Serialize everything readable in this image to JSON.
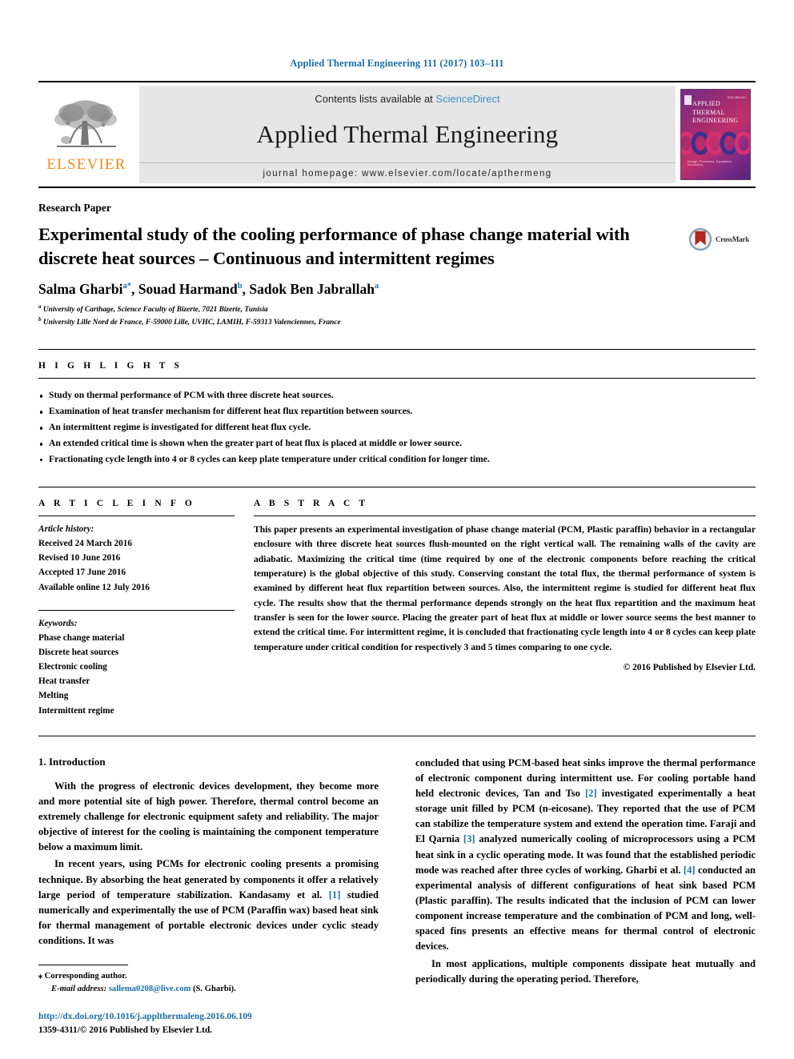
{
  "running_head": "Applied Thermal Engineering 111 (2017) 103–111",
  "masthead": {
    "publisher": "ELSEVIER",
    "contents_prefix": "Contents lists available at ",
    "sciencedirect": "ScienceDirect",
    "journal_name": "Applied Thermal Engineering",
    "homepage": "journal homepage: www.elsevier.com/locate/apthermeng",
    "cover": {
      "title_lines": [
        "APPLIED",
        "THERMAL",
        "ENGINEERING"
      ],
      "footer": "Design, Processes, Equipment, Economics",
      "issn": "ISSN 1359-4311"
    }
  },
  "article": {
    "type": "Research Paper",
    "title": "Experimental study of the cooling performance of phase change material with discrete heat sources – Continuous and intermittent regimes",
    "crossmark_label": "CrossMark",
    "authors": [
      {
        "name": "Salma Gharbi",
        "sup": "a",
        "star": "*"
      },
      {
        "name": "Souad Harmand",
        "sup": "b",
        "star": ""
      },
      {
        "name": "Sadok Ben Jabrallah",
        "sup": "a",
        "star": ""
      }
    ],
    "affiliations": [
      {
        "mark": "a",
        "text": "University of Carthage, Science Faculty of Bizerte, 7021 Bizerte, Tunisia"
      },
      {
        "mark": "b",
        "text": "University Lille Nord de France, F-59000 Lille, UVHC, LAMIH, F-59313 Valenciennes, France"
      }
    ]
  },
  "highlights": {
    "label": "H I G H L I G H T S",
    "items": [
      "Study on thermal performance of PCM with three discrete heat sources.",
      "Examination of heat transfer mechanism for different heat flux repartition between sources.",
      "An intermittent regime is investigated for different heat flux cycle.",
      "An extended critical time is shown when the greater part of heat flux is placed at middle or lower source.",
      "Fractionating cycle length into 4 or 8 cycles can keep plate temperature under critical condition for longer time."
    ]
  },
  "article_info": {
    "label": "A R T I C L E   I N F O",
    "history_label": "Article history:",
    "history": [
      "Received 24 March 2016",
      "Revised 10 June 2016",
      "Accepted 17 June 2016",
      "Available online 12 July 2016"
    ],
    "keywords_label": "Keywords:",
    "keywords": [
      "Phase change material",
      "Discrete heat sources",
      "Electronic cooling",
      "Heat transfer",
      "Melting",
      "Intermittent regime"
    ]
  },
  "abstract": {
    "label": "A B S T R A C T",
    "text": "This paper presents an experimental investigation of phase change material (PCM, Plastic paraffin) behavior in a rectangular enclosure with three discrete heat sources flush-mounted on the right vertical wall. The remaining walls of the cavity are adiabatic. Maximizing the critical time (time required by one of the electronic components before reaching the critical temperature) is the global objective of this study. Conserving constant the total flux, the thermal performance of system is examined by different heat flux repartition between sources. Also, the intermittent regime is studied for different heat flux cycle. The results show that the thermal performance depends strongly on the heat flux repartition and the maximum heat transfer is seen for the lower source. Placing the greater part of heat flux at middle or lower source seems the best manner to extend the critical time. For intermittent regime, it is concluded that fractionating cycle length into 4 or 8 cycles can keep plate temperature under critical condition for respectively 3 and 5 times comparing to one cycle.",
    "copyright": "© 2016 Published by Elsevier Ltd."
  },
  "body": {
    "section_title": "1. Introduction",
    "left_paragraphs": [
      "With the progress of electronic devices development, they become more and more potential site of high power. Therefore, thermal control become an extremely challenge for electronic equipment safety and reliability. The major objective of interest for the cooling is maintaining the component temperature below a maximum limit.",
      "In recent years, using PCMs for electronic cooling presents a promising technique. By absorbing the heat generated by components it offer a relatively large period of temperature stabilization. Kandasamy et al. [1] studied numerically and experimentally the use of PCM (Paraffin wax) based heat sink for thermal management of portable electronic devices under cyclic steady conditions. It was"
    ],
    "right_paragraphs": [
      "concluded that using PCM-based heat sinks improve the thermal performance of electronic component during intermittent use. For cooling portable hand held electronic devices, Tan and Tso [2] investigated experimentally a heat storage unit filled by PCM (n-eicosane). They reported that the use of PCM can stabilize the temperature system and extend the operation time. Faraji and El Qarnia [3] analyzed numerically cooling of microprocessors using a PCM heat sink in a cyclic operating mode. It was found that the established periodic mode was reached after three cycles of working. Gharbi et al. [4] conducted an experimental analysis of different configurations of heat sink based PCM (Plastic paraffin). The results indicated that the inclusion of PCM can lower component increase temperature and the combination of PCM and long, well-spaced fins presents an effective means for thermal control of electronic devices.",
      "In most applications, multiple components dissipate heat mutually and periodically during the operating period. Therefore,"
    ]
  },
  "footer": {
    "corresponding_star": "⁎",
    "corresponding_label": "Corresponding author.",
    "email_label": "E-mail address:",
    "email": "sallema0208@live.com",
    "email_suffix": "(S. Gharbi).",
    "doi": "http://dx.doi.org/10.1016/j.applthermaleng.2016.06.109",
    "issn_line": "1359-4311/© 2016 Published by Elsevier Ltd."
  },
  "colors": {
    "link_blue": "#1a6ea8",
    "sd_blue": "#3a8fc4",
    "elsevier_orange": "#F08C1B",
    "band_gray": "#e6e6e6"
  }
}
